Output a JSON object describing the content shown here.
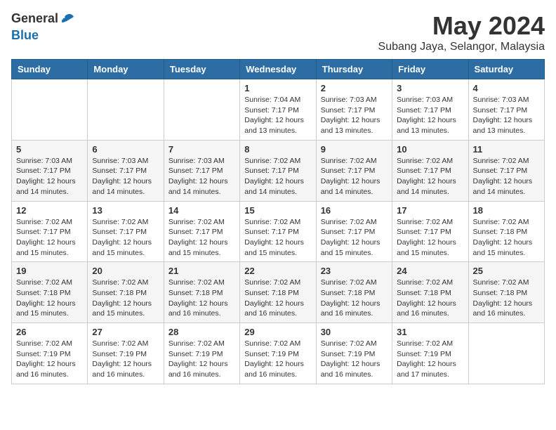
{
  "logo": {
    "text_general": "General",
    "text_blue": "Blue"
  },
  "title": "May 2024",
  "subtitle": "Subang Jaya, Selangor, Malaysia",
  "days": [
    "Sunday",
    "Monday",
    "Tuesday",
    "Wednesday",
    "Thursday",
    "Friday",
    "Saturday"
  ],
  "weeks": [
    [
      {
        "date": "",
        "sunrise": "",
        "sunset": "",
        "daylight": ""
      },
      {
        "date": "",
        "sunrise": "",
        "sunset": "",
        "daylight": ""
      },
      {
        "date": "",
        "sunrise": "",
        "sunset": "",
        "daylight": ""
      },
      {
        "date": "1",
        "sunrise": "Sunrise: 7:04 AM",
        "sunset": "Sunset: 7:17 PM",
        "daylight": "Daylight: 12 hours and 13 minutes."
      },
      {
        "date": "2",
        "sunrise": "Sunrise: 7:03 AM",
        "sunset": "Sunset: 7:17 PM",
        "daylight": "Daylight: 12 hours and 13 minutes."
      },
      {
        "date": "3",
        "sunrise": "Sunrise: 7:03 AM",
        "sunset": "Sunset: 7:17 PM",
        "daylight": "Daylight: 12 hours and 13 minutes."
      },
      {
        "date": "4",
        "sunrise": "Sunrise: 7:03 AM",
        "sunset": "Sunset: 7:17 PM",
        "daylight": "Daylight: 12 hours and 13 minutes."
      }
    ],
    [
      {
        "date": "5",
        "sunrise": "Sunrise: 7:03 AM",
        "sunset": "Sunset: 7:17 PM",
        "daylight": "Daylight: 12 hours and 14 minutes."
      },
      {
        "date": "6",
        "sunrise": "Sunrise: 7:03 AM",
        "sunset": "Sunset: 7:17 PM",
        "daylight": "Daylight: 12 hours and 14 minutes."
      },
      {
        "date": "7",
        "sunrise": "Sunrise: 7:03 AM",
        "sunset": "Sunset: 7:17 PM",
        "daylight": "Daylight: 12 hours and 14 minutes."
      },
      {
        "date": "8",
        "sunrise": "Sunrise: 7:02 AM",
        "sunset": "Sunset: 7:17 PM",
        "daylight": "Daylight: 12 hours and 14 minutes."
      },
      {
        "date": "9",
        "sunrise": "Sunrise: 7:02 AM",
        "sunset": "Sunset: 7:17 PM",
        "daylight": "Daylight: 12 hours and 14 minutes."
      },
      {
        "date": "10",
        "sunrise": "Sunrise: 7:02 AM",
        "sunset": "Sunset: 7:17 PM",
        "daylight": "Daylight: 12 hours and 14 minutes."
      },
      {
        "date": "11",
        "sunrise": "Sunrise: 7:02 AM",
        "sunset": "Sunset: 7:17 PM",
        "daylight": "Daylight: 12 hours and 14 minutes."
      }
    ],
    [
      {
        "date": "12",
        "sunrise": "Sunrise: 7:02 AM",
        "sunset": "Sunset: 7:17 PM",
        "daylight": "Daylight: 12 hours and 15 minutes."
      },
      {
        "date": "13",
        "sunrise": "Sunrise: 7:02 AM",
        "sunset": "Sunset: 7:17 PM",
        "daylight": "Daylight: 12 hours and 15 minutes."
      },
      {
        "date": "14",
        "sunrise": "Sunrise: 7:02 AM",
        "sunset": "Sunset: 7:17 PM",
        "daylight": "Daylight: 12 hours and 15 minutes."
      },
      {
        "date": "15",
        "sunrise": "Sunrise: 7:02 AM",
        "sunset": "Sunset: 7:17 PM",
        "daylight": "Daylight: 12 hours and 15 minutes."
      },
      {
        "date": "16",
        "sunrise": "Sunrise: 7:02 AM",
        "sunset": "Sunset: 7:17 PM",
        "daylight": "Daylight: 12 hours and 15 minutes."
      },
      {
        "date": "17",
        "sunrise": "Sunrise: 7:02 AM",
        "sunset": "Sunset: 7:17 PM",
        "daylight": "Daylight: 12 hours and 15 minutes."
      },
      {
        "date": "18",
        "sunrise": "Sunrise: 7:02 AM",
        "sunset": "Sunset: 7:18 PM",
        "daylight": "Daylight: 12 hours and 15 minutes."
      }
    ],
    [
      {
        "date": "19",
        "sunrise": "Sunrise: 7:02 AM",
        "sunset": "Sunset: 7:18 PM",
        "daylight": "Daylight: 12 hours and 15 minutes."
      },
      {
        "date": "20",
        "sunrise": "Sunrise: 7:02 AM",
        "sunset": "Sunset: 7:18 PM",
        "daylight": "Daylight: 12 hours and 15 minutes."
      },
      {
        "date": "21",
        "sunrise": "Sunrise: 7:02 AM",
        "sunset": "Sunset: 7:18 PM",
        "daylight": "Daylight: 12 hours and 16 minutes."
      },
      {
        "date": "22",
        "sunrise": "Sunrise: 7:02 AM",
        "sunset": "Sunset: 7:18 PM",
        "daylight": "Daylight: 12 hours and 16 minutes."
      },
      {
        "date": "23",
        "sunrise": "Sunrise: 7:02 AM",
        "sunset": "Sunset: 7:18 PM",
        "daylight": "Daylight: 12 hours and 16 minutes."
      },
      {
        "date": "24",
        "sunrise": "Sunrise: 7:02 AM",
        "sunset": "Sunset: 7:18 PM",
        "daylight": "Daylight: 12 hours and 16 minutes."
      },
      {
        "date": "25",
        "sunrise": "Sunrise: 7:02 AM",
        "sunset": "Sunset: 7:18 PM",
        "daylight": "Daylight: 12 hours and 16 minutes."
      }
    ],
    [
      {
        "date": "26",
        "sunrise": "Sunrise: 7:02 AM",
        "sunset": "Sunset: 7:19 PM",
        "daylight": "Daylight: 12 hours and 16 minutes."
      },
      {
        "date": "27",
        "sunrise": "Sunrise: 7:02 AM",
        "sunset": "Sunset: 7:19 PM",
        "daylight": "Daylight: 12 hours and 16 minutes."
      },
      {
        "date": "28",
        "sunrise": "Sunrise: 7:02 AM",
        "sunset": "Sunset: 7:19 PM",
        "daylight": "Daylight: 12 hours and 16 minutes."
      },
      {
        "date": "29",
        "sunrise": "Sunrise: 7:02 AM",
        "sunset": "Sunset: 7:19 PM",
        "daylight": "Daylight: 12 hours and 16 minutes."
      },
      {
        "date": "30",
        "sunrise": "Sunrise: 7:02 AM",
        "sunset": "Sunset: 7:19 PM",
        "daylight": "Daylight: 12 hours and 16 minutes."
      },
      {
        "date": "31",
        "sunrise": "Sunrise: 7:02 AM",
        "sunset": "Sunset: 7:19 PM",
        "daylight": "Daylight: 12 hours and 17 minutes."
      },
      {
        "date": "",
        "sunrise": "",
        "sunset": "",
        "daylight": ""
      }
    ]
  ]
}
